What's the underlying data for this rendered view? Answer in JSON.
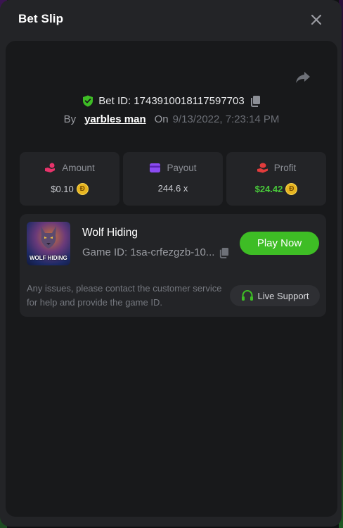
{
  "modal": {
    "title": "Bet Slip"
  },
  "bet": {
    "id_label": "Bet ID: 1743910018117597703",
    "by_label": "By",
    "user": "yarbles man",
    "on_label": "On",
    "date": "9/13/2022, 7:23:14 PM"
  },
  "stats": [
    {
      "label": "Amount",
      "value": "$0.10",
      "icon": "hand-coin-icon",
      "color": "#e8336b"
    },
    {
      "label": "Payout",
      "value": "244.6 x",
      "icon": "wallet-icon",
      "color": "#8b4bf2"
    },
    {
      "label": "Profit",
      "value": "$24.42",
      "icon": "hand-money-icon",
      "color": "#e23c3c"
    }
  ],
  "game": {
    "name": "Wolf Hiding",
    "id_text": "Game ID: 1sa-crfezgzb-10...",
    "thumb_title": "WOLF HIDING",
    "play_label": "Play Now",
    "play_color": "#3ebd25"
  },
  "support": {
    "message": "Any issues, please contact the customer service for help and provide the game ID.",
    "button_label": "Live Support",
    "icon_color": "#3ebd25"
  },
  "coin_symbol": "Đ",
  "accent_green": "#48c73a"
}
